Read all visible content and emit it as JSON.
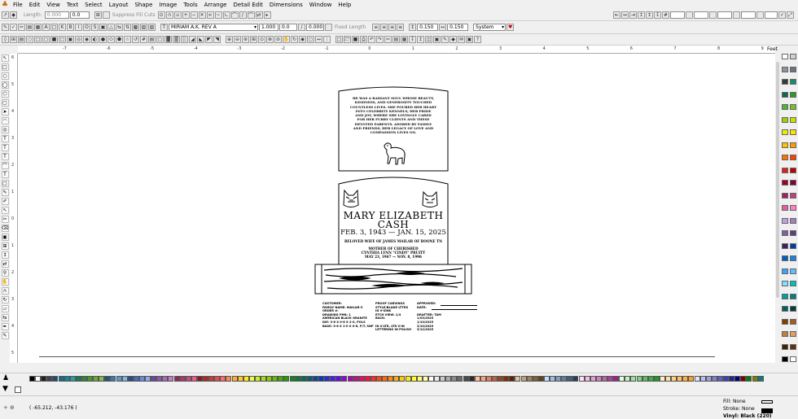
{
  "menu": [
    "File",
    "Edit",
    "View",
    "Text",
    "Select",
    "Layout",
    "Shape",
    "Image",
    "Tools",
    "Arrange",
    "Detail Edit",
    "Dimensions",
    "Window",
    "Help"
  ],
  "toolbar1": {
    "length_label": "Length:",
    "length_value": "0.000",
    "angle_value": "0.0",
    "suppress_label": "Suppress Fill Cuts"
  },
  "toolbar2": {
    "font": "MIRIAM A.K. REV A",
    "size": "1.000",
    "spacing": "0.0",
    "slant": "0.000",
    "fixed_length": "Fixed Length",
    "line1": "0.150",
    "line2": "0.150",
    "units": "System",
    "feet": "Feet"
  },
  "ruler_top": [
    "-7",
    "-6",
    "-5",
    "-4",
    "-3",
    "-2",
    "-1",
    "0",
    "1",
    "2",
    "3",
    "4",
    "5",
    "6",
    "7",
    "8",
    "9"
  ],
  "ruler_left": [
    "6",
    "5",
    "4",
    "3",
    "2",
    "1",
    "0",
    "1",
    "2",
    "3",
    "4",
    "5"
  ],
  "memorial": {
    "epitaph": [
      "HE WAS A RADIANT SOUL WHOSE BEAUTY,",
      "KINDNESS, AND GENEROSITY TOUCHED",
      "COUNTLESS LIVES. SHE POURED HER HEART",
      "INTO CELEBRITY KENNELS, HER PRIDE",
      "AND JOY, WHERE SHE LOVINGLY CARED",
      "FOR HER FURRY CLIENTS AND THESE",
      "DEVOTED PARENTS. ADORED BY FAMILY",
      "AND FRIENDS, HER LEGACY OF LOVE AND",
      "COMPASSION LIVES ON."
    ],
    "name1": "MARY ELIZABETH",
    "name2": "CASH",
    "dates": "FEB. 3, 1943 — JAN. 15, 2025",
    "beloved": "BELOVED WIFE OF JAMES MAILAR OF BOONE TN",
    "mother": "MOTHER OF CHERISHED",
    "child1": "CYNTHIA LYNN \"CINDY\" PRUITT",
    "child2": "MAY 23, 1967 — NOV. 8, 1996"
  },
  "info_block": {
    "col1": "CUSTOMER:\nFAMILY NAME: MAILAR-3\nORDER #:\nDRAWING PHN: 1\nAMERICAN BLACK GRANITE\nDIE: 3-6 X 0-6 X 2-0, POLS\nBASE: 3-6 X 1-0 X 0-6, P/T, SNP",
    "col2": "PROOF CARVINGS\nSTYLE/BLADE LTTRS\nIN V-SINK\nETCH VIEW: 1/4\nBACK:\n\nIN V-LTR, LTR V-IN\nLETTERING IN POLISH",
    "col3": "APPROVED:\nDATE:\n\nDRAFTER: TAM\n1/03/2025\n1/10/2025\n3/10/2025\n3/12/2025"
  },
  "status": {
    "coords": "( -65.212, -43.176 )",
    "fill": "Fill: None",
    "stroke": "Stroke: None",
    "vinyl": "Vinyl: Black (220)"
  },
  "colors": {
    "right_palette": [
      "#ffffff",
      "#d0d0d0",
      "#9090a0",
      "#707080",
      "#3a3a3a",
      "#1a8a6a",
      "#0a6a4a",
      "#2a9a2a",
      "#4aba2a",
      "#7ac020",
      "#a0d000",
      "#c8e000",
      "#e8f000",
      "#ffe000",
      "#ffc000",
      "#ff9a00",
      "#ff7000",
      "#ff4000",
      "#e02020",
      "#c00000",
      "#a00020",
      "#800040",
      "#a02060",
      "#c04080",
      "#e060a0",
      "#ff80c0",
      "#c0a0e0",
      "#a080c0",
      "#8060a0",
      "#604080",
      "#402060",
      "#0040a0",
      "#0060c0",
      "#2080e0",
      "#40a0ff",
      "#60c0ff",
      "#80e0ff",
      "#00c0c0",
      "#00a0a0",
      "#008080",
      "#006060",
      "#004040",
      "#804000",
      "#a06020",
      "#c08040",
      "#e0a060",
      "#402000",
      "#603010",
      "#000000",
      "#ffffff"
    ],
    "bottom_palette": [
      "#000000",
      "#ffffff",
      "#202020",
      "#404050",
      "#2a4a6a",
      "#1a6a8a",
      "#0a8a9a",
      "#2aa0a0",
      "#1a7a5a",
      "#2a8a3a",
      "#4a9a2a",
      "#6aaa3a",
      "#8aba4a",
      "#1a5a7a",
      "#3a7aaa",
      "#5a9aca",
      "#7abaea",
      "#2a4a8a",
      "#4a6aba",
      "#6a8ada",
      "#8aaafa",
      "#6a4a9a",
      "#8a5aaa",
      "#aa6aba",
      "#ca7aca",
      "#8a2a5a",
      "#aa3a6a",
      "#ca4a7a",
      "#ea5a8a",
      "#8a1a1a",
      "#aa2a2a",
      "#ca3a3a",
      "#ea4a4a",
      "#ff6a6a",
      "#ff8a4a",
      "#ffaa3a",
      "#ffca2a",
      "#ffea1a",
      "#eaff3a",
      "#caea2a",
      "#aada1a",
      "#8aca0a",
      "#6aba0a",
      "#4aaa0a",
      "#2a9a0a",
      "#0a8a1a",
      "#0a7a3a",
      "#0a6a5a",
      "#0a5a7a",
      "#0a4a9a",
      "#0a3aba",
      "#2a2ada",
      "#4a1afa",
      "#6a0aea",
      "#8a0aca",
      "#aa0aaa",
      "#ca0a8a",
      "#ea0a6a",
      "#ff0a4a",
      "#ff2a2a",
      "#ff4a0a",
      "#ff6a0a",
      "#ff8a0a",
      "#ffaa0a",
      "#ffca0a",
      "#ffea0a",
      "#ffff2a",
      "#ffff6a",
      "#ffffaa",
      "#ffffea",
      "#eaeaea",
      "#cacaca",
      "#aaaaaa",
      "#8a8a8a",
      "#6a6a6a",
      "#4a4a4a",
      "#2a2a2a",
      "#ffc0a0",
      "#ffa080",
      "#e08060",
      "#c06040",
      "#a04020",
      "#803000",
      "#602000",
      "#e0c0a0",
      "#c0a080",
      "#a08060",
      "#806040",
      "#604020",
      "#c0e0ff",
      "#a0c0e0",
      "#80a0c0",
      "#6080a0",
      "#406080",
      "#204060",
      "#ffe0f0",
      "#f0c0e0",
      "#e0a0d0",
      "#d080c0",
      "#c060b0",
      "#b040a0",
      "#a02090",
      "#e0ffe0",
      "#c0f0c0",
      "#a0e0a0",
      "#80d080",
      "#60c060",
      "#40b040",
      "#20a020",
      "#fff0c0",
      "#ffe0a0",
      "#ffd080",
      "#ffc060",
      "#ffb040",
      "#ffa020",
      "#e0e0ff",
      "#c0c0f0",
      "#a0a0e0",
      "#8080d0",
      "#6060c0",
      "#4040b0",
      "#2020a0",
      "#000080",
      "#800000",
      "#008000",
      "#808000",
      "#008080"
    ]
  }
}
